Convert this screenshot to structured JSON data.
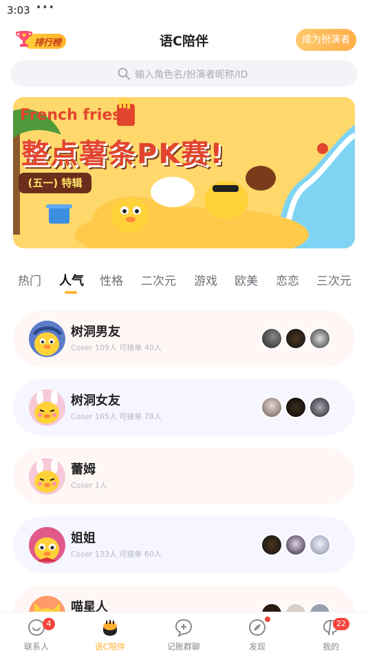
{
  "status_bar": {
    "time": "3:03",
    "dots": "•••"
  },
  "header": {
    "ranking_label": "排行榜",
    "title": "语C陪伴",
    "become_actor_label": "成为扮演者"
  },
  "search": {
    "placeholder": "输入角色名/扮演者昵称/ID"
  },
  "banner": {
    "line1": "French fries",
    "line2": "整点薯条PK赛!",
    "line3": "(五一) 特辑"
  },
  "tabs": [
    {
      "label": "热门"
    },
    {
      "label": "人气",
      "active": true
    },
    {
      "label": "性格"
    },
    {
      "label": "二次元"
    },
    {
      "label": "游戏"
    },
    {
      "label": "欧美"
    },
    {
      "label": "恋恋"
    },
    {
      "label": "三次元"
    }
  ],
  "cards": [
    {
      "name": "树洞男友",
      "subtitle": "Coser 109人  可接单 40人",
      "theme": "pink"
    },
    {
      "name": "树洞女友",
      "subtitle": "Coser 165人  可接单 78人",
      "theme": "blue"
    },
    {
      "name": "蕾姆",
      "subtitle": "Coser 1人",
      "theme": "pink"
    },
    {
      "name": "姐姐",
      "subtitle": "Coser 133人  可接单 60人",
      "theme": "blue"
    },
    {
      "name": "喵星人",
      "subtitle": "",
      "theme": "pink"
    }
  ],
  "tabbar": [
    {
      "label": "联系人",
      "badge": "4"
    },
    {
      "label": "语C陪伴",
      "active": true
    },
    {
      "label": "记账群聊"
    },
    {
      "label": "发现",
      "dot": true
    },
    {
      "label": "我的",
      "badge": "22"
    }
  ],
  "colors": {
    "accent": "#ffb62e",
    "badge": "#f2453d",
    "banner_bg": "#ffd86b"
  }
}
